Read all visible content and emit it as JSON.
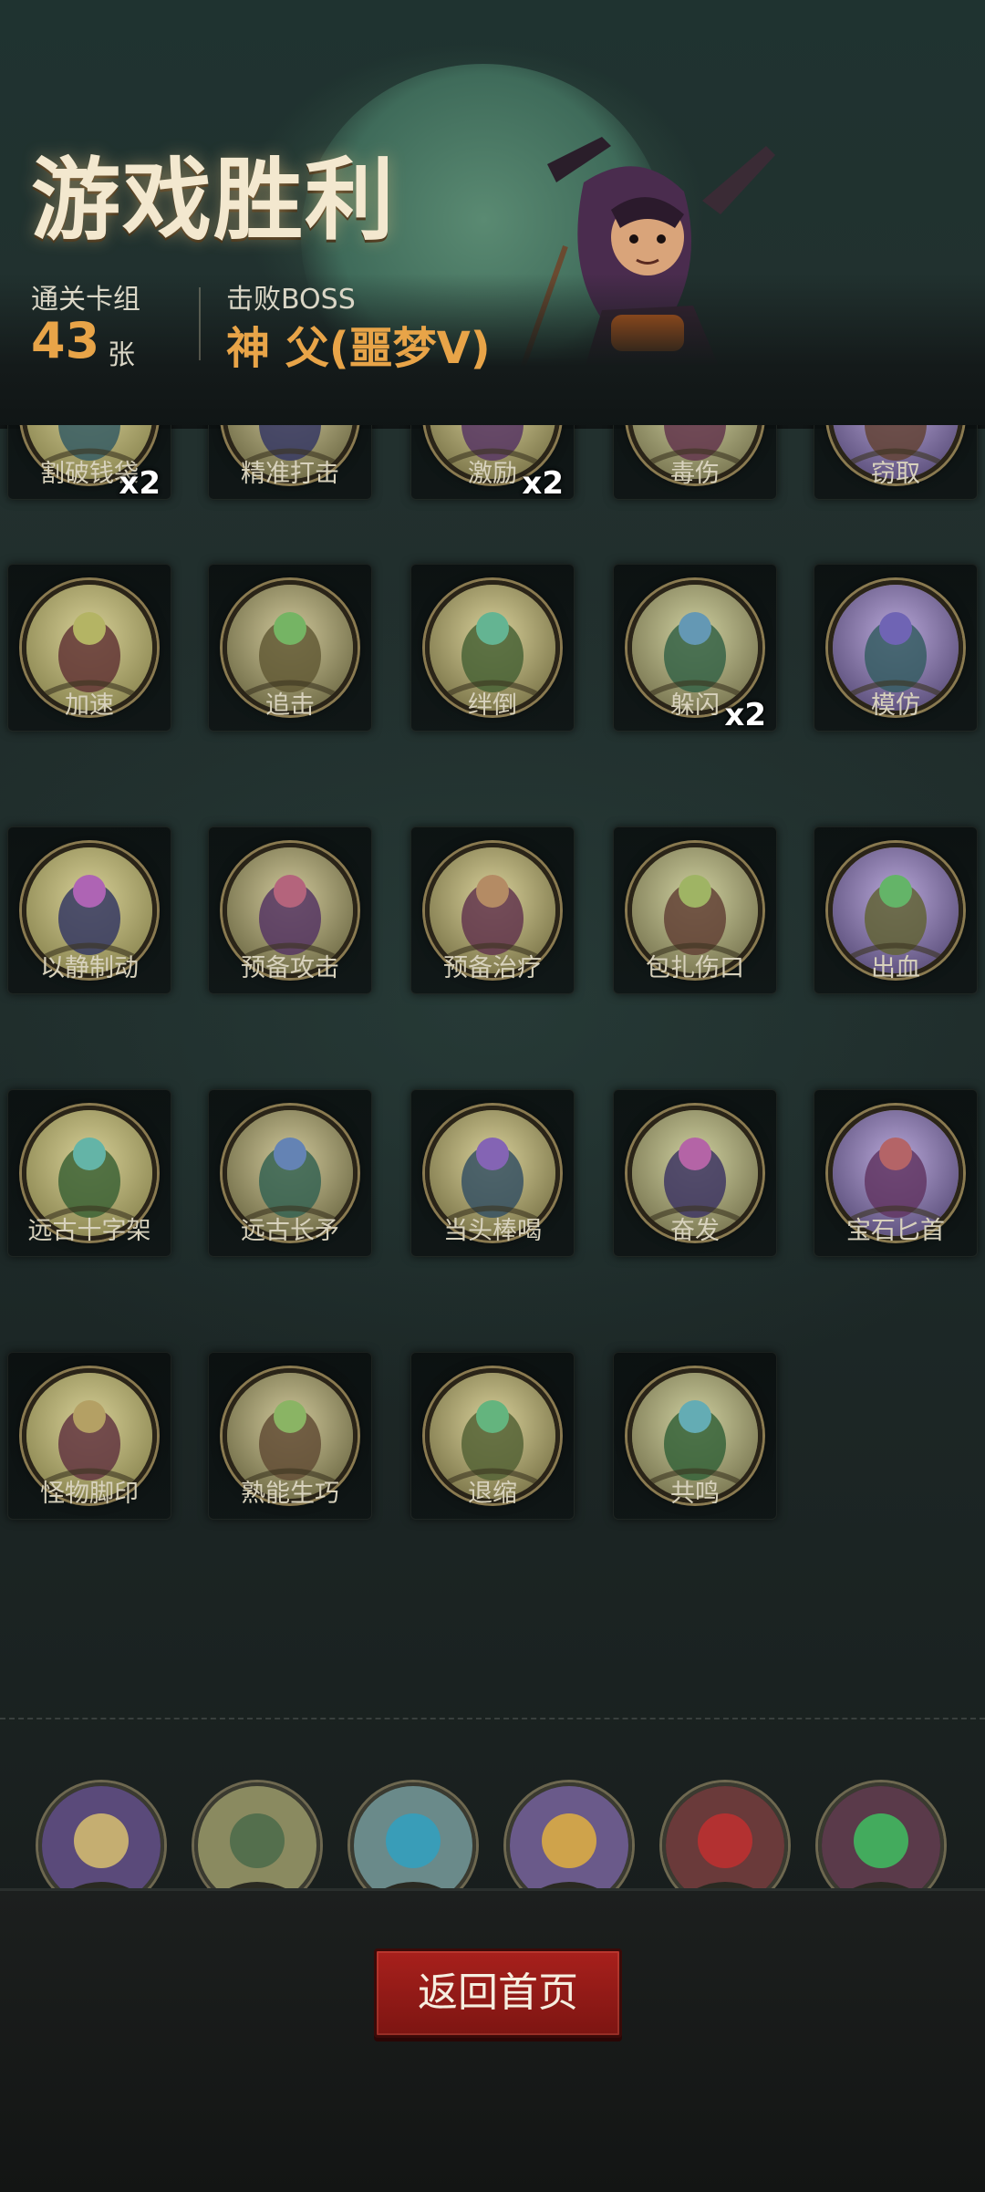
{
  "header": {
    "title": "游戏胜利",
    "cleared_deck_label": "通关卡组",
    "cleared_deck_count": "43",
    "cleared_deck_unit": "张",
    "boss_label": "击败BOSS",
    "boss_name": "神 父(噩梦V)"
  },
  "cards_partial": [
    {
      "name": "割破钱袋",
      "badge": "x2"
    },
    {
      "name": "精准打击",
      "badge": ""
    },
    {
      "name": "激励",
      "badge": "x2"
    },
    {
      "name": "毒伤",
      "badge": ""
    },
    {
      "name": "窃取",
      "badge": ""
    }
  ],
  "cards": [
    {
      "name": "加速",
      "badge": ""
    },
    {
      "name": "追击",
      "badge": ""
    },
    {
      "name": "绊倒",
      "badge": ""
    },
    {
      "name": "躲闪",
      "badge": "x2"
    },
    {
      "name": "模仿",
      "badge": ""
    },
    {
      "name": "以静制动",
      "badge": ""
    },
    {
      "name": "预备攻击",
      "badge": ""
    },
    {
      "name": "预备治疗",
      "badge": ""
    },
    {
      "name": "包扎伤口",
      "badge": ""
    },
    {
      "name": "出血",
      "badge": ""
    },
    {
      "name": "远古十字架",
      "badge": ""
    },
    {
      "name": "远古长矛",
      "badge": ""
    },
    {
      "name": "当头棒喝",
      "badge": ""
    },
    {
      "name": "奋发",
      "badge": ""
    },
    {
      "name": "宝石匕首",
      "badge": ""
    },
    {
      "name": "怪物脚印",
      "badge": ""
    },
    {
      "name": "熟能生巧",
      "badge": ""
    },
    {
      "name": "退缩",
      "badge": ""
    },
    {
      "name": "共鸣",
      "badge": ""
    }
  ],
  "relics": [
    "cat-relic-icon",
    "archer-relic-icon",
    "cards-hand-relic-icon",
    "gold-hand-relic-icon",
    "assassin-relic-icon",
    "ghoul-relic-icon"
  ],
  "buttons": {
    "return_home": "返回首页"
  },
  "colors": {
    "accent_gold": "#e8a448",
    "button_red": "#a8201c"
  }
}
